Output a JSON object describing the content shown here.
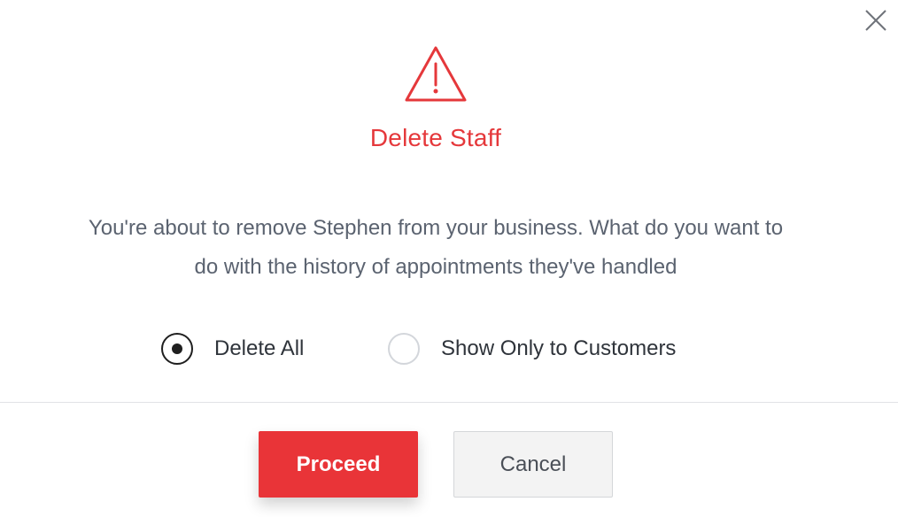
{
  "dialog": {
    "title": "Delete Staff",
    "message_line1": "You're about to remove Stephen from your business. What do you want to",
    "message_line2": "do with the history of appointments they've handled",
    "options": [
      {
        "label": "Delete All",
        "selected": true
      },
      {
        "label": "Show Only to Customers",
        "selected": false
      }
    ],
    "proceed_label": "Proceed",
    "cancel_label": "Cancel"
  },
  "icons": {
    "close": "close-icon",
    "warning": "warning-triangle-icon"
  },
  "colors": {
    "accent_red": "#e93438",
    "title_red": "#e5383b",
    "text_gray": "#5b6370"
  }
}
